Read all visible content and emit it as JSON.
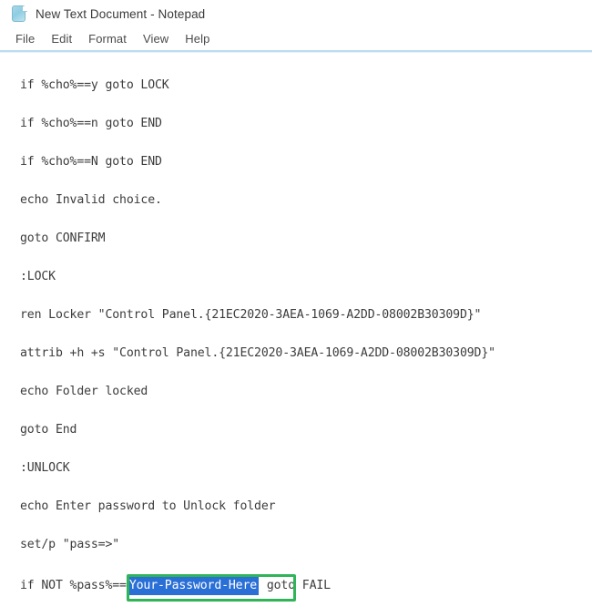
{
  "window": {
    "title": "New Text Document - Notepad",
    "icon": "notepad-document-icon"
  },
  "menubar": {
    "items": [
      {
        "label": "File"
      },
      {
        "label": "Edit"
      },
      {
        "label": "Format"
      },
      {
        "label": "View"
      },
      {
        "label": "Help"
      }
    ]
  },
  "editor": {
    "lines": [
      {
        "text": "if %cho%==y goto LOCK"
      },
      {
        "text": "if %cho%==n goto END"
      },
      {
        "text": "if %cho%==N goto END"
      },
      {
        "text": "echo Invalid choice."
      },
      {
        "text": "goto CONFIRM"
      },
      {
        "text": ":LOCK"
      },
      {
        "text": "ren Locker \"Control Panel.{21EC2020-3AEA-1069-A2DD-08002B30309D}\""
      },
      {
        "text": "attrib +h +s \"Control Panel.{21EC2020-3AEA-1069-A2DD-08002B30309D}\""
      },
      {
        "text": "echo Folder locked"
      },
      {
        "text": "goto End"
      },
      {
        "text": ":UNLOCK"
      },
      {
        "text": "echo Enter password to Unlock folder"
      },
      {
        "text": "set/p \"pass=>\""
      }
    ],
    "last_line": {
      "prefix": "if NOT %pass%==",
      "selected_text": "Your-Password-Here",
      "suffix": " goto FAIL"
    }
  },
  "annotation": {
    "type": "highlight-rectangle",
    "color": "#2fb457",
    "target": "Your-Password-Here"
  },
  "colors": {
    "selection_background": "#2a6fd6",
    "selection_text": "#ffffff",
    "annotation_green": "#2fb457",
    "menu_separator": "#bcdcf0",
    "text": "#3c3c3c",
    "background": "#ffffff"
  }
}
